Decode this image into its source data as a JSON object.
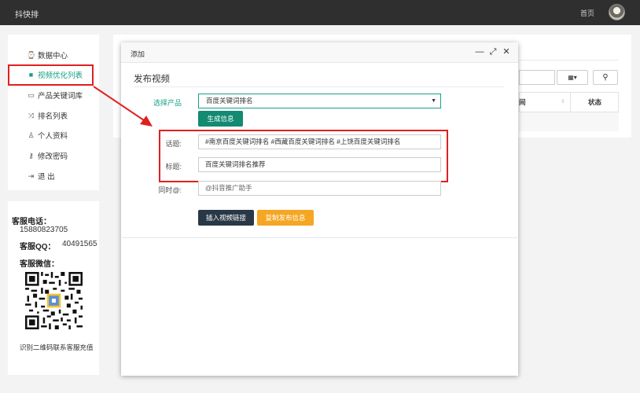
{
  "app": {
    "brand": "抖快排",
    "home": "首页"
  },
  "sidebar": {
    "items": [
      {
        "label": "数据中心",
        "icon": "dashboard-icon",
        "glyph": "⌚"
      },
      {
        "label": "视频优化列表",
        "icon": "video-icon",
        "glyph": "■"
      },
      {
        "label": "产品关键词库",
        "icon": "laptop-icon",
        "glyph": "▭"
      },
      {
        "label": "排名列表",
        "icon": "shuffle-icon",
        "glyph": "⤨"
      },
      {
        "label": "个人资料",
        "icon": "user-icon",
        "glyph": "♙"
      },
      {
        "label": "修改密码",
        "icon": "key-icon",
        "glyph": "⚷"
      },
      {
        "label": "退 出",
        "icon": "logout-icon",
        "glyph": "⇥"
      }
    ],
    "active_index": 1
  },
  "contact": {
    "phone_label": "客服电话：",
    "phone": "15880823705",
    "qq_label": "客服QQ：",
    "qq": "40491565",
    "wechat_label": "客服微信：",
    "qr_caption": "识别二维码联系客服充值"
  },
  "background_table": {
    "grid_button": "▦▾",
    "search_button": "⚲",
    "col_time": "间",
    "col_status": "状态",
    "sort_glyph": "⇳"
  },
  "modal": {
    "title": "添加",
    "controls": {
      "minimize": "—",
      "maximize": "⤢",
      "close": "✕"
    },
    "section_title": "发布视频",
    "product_label": "选择产品",
    "product_value": "百度关键词排名",
    "generate_button": "生成信息",
    "topic_label": "话题:",
    "topic_value": "#南京百度关键词排名 #西藏百度关键词排名 #上饶百度关键词排名",
    "headline_label": "标题:",
    "headline_value": "百度关键词排名推荐",
    "mention_label": "同时@:",
    "mention_value": "@抖音推广助手",
    "insert_button": "插入视频链接",
    "copy_button": "复制发布信息"
  },
  "colors": {
    "accent": "#16a085",
    "topbar": "#2f2f2f",
    "annotation": "#e02020",
    "dark_button": "#293846",
    "orange_button": "#f5a623"
  }
}
